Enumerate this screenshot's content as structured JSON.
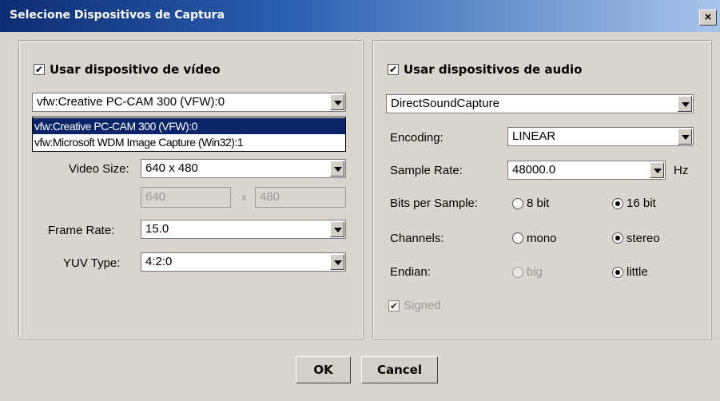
{
  "window": {
    "title": "Selecione Dispositivos de Captura",
    "close": "×"
  },
  "video": {
    "use_label": "Usar dispositivo de vídeo",
    "use_checked": "✔",
    "device_selected": "vfw:Creative PC-CAM 300 (VFW):0",
    "device_options": [
      "vfw:Creative PC-CAM 300 (VFW):0",
      "vfw:Microsoft WDM Image Capture (Win32):1"
    ],
    "size_label": "Video Size:",
    "size_value": "640 x 480",
    "width": "640",
    "x_sep": "x",
    "height": "480",
    "frame_rate_label": "Frame Rate:",
    "frame_rate_value": "15.0",
    "yuv_label": "YUV Type:",
    "yuv_value": "4:2:0"
  },
  "audio": {
    "use_label": "Usar dispositivos de audio",
    "use_checked": "✔",
    "device_selected": "DirectSoundCapture",
    "encoding_label": "Encoding:",
    "encoding_value": "LINEAR",
    "sample_rate_label": "Sample Rate:",
    "sample_rate_value": "48000.0",
    "sample_rate_unit": "Hz",
    "bits_label": "Bits per Sample:",
    "bits_opt1": "8 bit",
    "bits_opt2": "16 bit",
    "channels_label": "Channels:",
    "channels_opt1": "mono",
    "channels_opt2": "stereo",
    "endian_label": "Endian:",
    "endian_opt1": "big",
    "endian_opt2": "little",
    "signed_label": "Signed",
    "signed_checked": "✔"
  },
  "buttons": {
    "ok": "OK",
    "cancel": "Cancel"
  }
}
